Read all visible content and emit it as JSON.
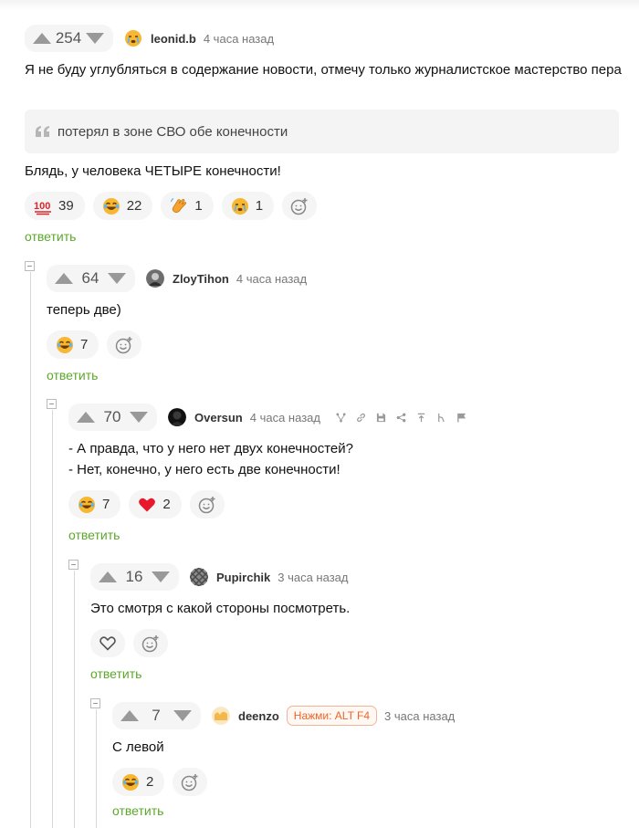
{
  "comments": [
    {
      "rating": "254",
      "author": "leonid.b",
      "time": "4 часа назад",
      "text": "Я не буду углубляться в содержание новости, отмечу только журналистское мастерство пера",
      "quote": "потерял в зоне СВО обе конечности",
      "text2": "Блядь, у человека ЧЕТЫРЕ конечности!",
      "reactions": [
        {
          "icon": "hundred-points-icon",
          "count": "39"
        },
        {
          "icon": "laughing-face-icon",
          "count": "22"
        },
        {
          "icon": "waving-hand-icon",
          "count": "1"
        },
        {
          "icon": "crying-face-icon",
          "count": "1"
        }
      ],
      "reply_label": "ответить"
    },
    {
      "rating": "64",
      "author": "ZloyTihon",
      "time": "4 часа назад",
      "text": "теперь две)",
      "reactions": [
        {
          "icon": "laughing-face-icon",
          "count": "7"
        }
      ],
      "reply_label": "ответить"
    },
    {
      "rating": "70",
      "author": "Oversun",
      "time": "4 часа назад",
      "text_lines": [
        "- А правда, что у него нет двух конечностей?",
        "- Нет, конечно, у него есть две конечности!"
      ],
      "tools": [
        "hierarchy-icon",
        "link-icon",
        "save-icon",
        "share-icon",
        "upload-icon",
        "user-icon",
        "flag-icon"
      ],
      "reactions": [
        {
          "icon": "laughing-face-icon",
          "count": "7"
        },
        {
          "icon": "heart-icon",
          "count": "2"
        }
      ],
      "reply_label": "ответить"
    },
    {
      "rating": "16",
      "author": "Pupirchik",
      "time": "3 часа назад",
      "text": "Это смотря с какой стороны посмотреть.",
      "reactions": [],
      "reply_label": "ответить"
    },
    {
      "rating": "7",
      "author": "deenzo",
      "badge": "Нажми: ALT F4",
      "time": "3 часа назад",
      "text": "С левой",
      "reactions": [
        {
          "icon": "laughing-face-icon",
          "count": "2"
        }
      ],
      "reply_label": "ответить"
    }
  ],
  "colors": {
    "accent_green": "#5ca82a",
    "badge_orange": "#e8672c",
    "pill_bg": "#f5f5f5",
    "heart_red": "#e8172c"
  }
}
